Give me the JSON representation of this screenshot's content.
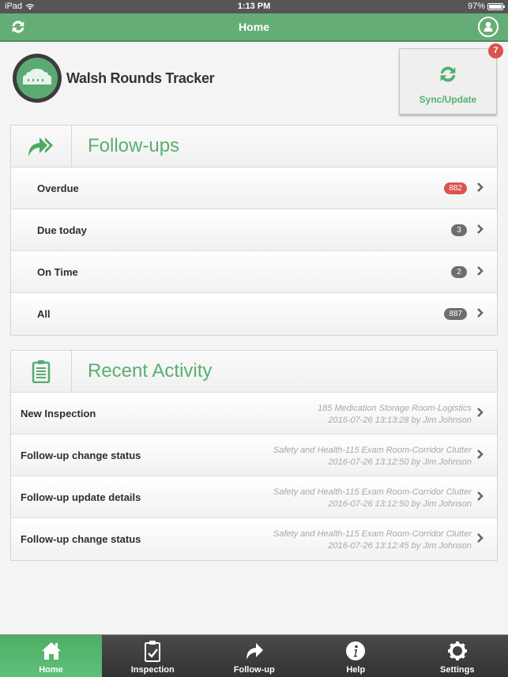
{
  "status_bar": {
    "device": "iPad",
    "time": "1:13 PM",
    "battery": "97%",
    "battery_level": 0.97
  },
  "nav": {
    "title": "Home",
    "left_icon": "refresh-icon",
    "right_icon": "profile-icon"
  },
  "brand": {
    "name": "Walsh Rounds Tracker"
  },
  "sync": {
    "label": "Sync/Update",
    "badge": "7"
  },
  "followups": {
    "title": "Follow-ups",
    "icon": "forward-arrow-icon",
    "items": [
      {
        "label": "Overdue",
        "count": "882",
        "status": "danger"
      },
      {
        "label": "Due today",
        "count": "3",
        "status": "neutral"
      },
      {
        "label": "On Time",
        "count": "2",
        "status": "neutral"
      },
      {
        "label": "All",
        "count": "887",
        "status": "neutral"
      }
    ]
  },
  "activity": {
    "title": "Recent Activity",
    "icon": "clipboard-icon",
    "items": [
      {
        "label": "New Inspection",
        "detail": "185 Medication Storage Room-Logistics",
        "timestamp": "2016-07-26 13:13:28 by Jim Johnson"
      },
      {
        "label": "Follow-up change status",
        "detail": "Safety and Health-115 Exam Room-Corridor Clutter",
        "timestamp": "2016-07-26 13:12:50 by Jim Johnson"
      },
      {
        "label": "Follow-up update details",
        "detail": "Safety and Health-115 Exam Room-Corridor Clutter",
        "timestamp": "2016-07-26 13:12:50 by Jim Johnson"
      },
      {
        "label": "Follow-up change status",
        "detail": "Safety and Health-115 Exam Room-Corridor Clutter",
        "timestamp": "2016-07-26 13:12:45 by Jim Johnson"
      }
    ]
  },
  "tabs": [
    {
      "label": "Home",
      "icon": "home-icon",
      "active": true
    },
    {
      "label": "Inspection",
      "icon": "clipboard-check-icon",
      "active": false
    },
    {
      "label": "Follow-up",
      "icon": "share-arrow-icon",
      "active": false
    },
    {
      "label": "Help",
      "icon": "info-icon",
      "active": false
    },
    {
      "label": "Settings",
      "icon": "gear-icon",
      "active": false
    }
  ],
  "colors": {
    "brand_green": "#65ad76",
    "accent_green": "#5aaf70",
    "danger_red": "#d9534f",
    "badge_gray": "#6e6e6e"
  }
}
